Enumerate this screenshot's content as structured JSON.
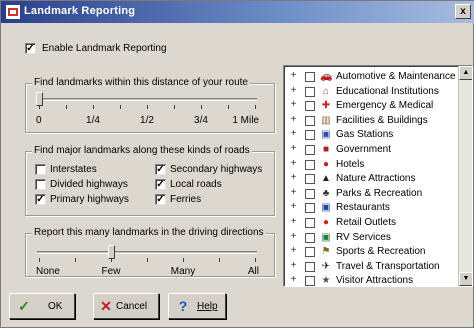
{
  "window": {
    "title": "Landmark Reporting",
    "close_label": "x"
  },
  "enable": {
    "label": "Enable Landmark Reporting",
    "checked": true
  },
  "distance": {
    "title": "Find landmarks within this distance of your route",
    "labels": [
      "0",
      "1/4",
      "1/2",
      "3/4",
      "1 Mile"
    ],
    "value_fraction": 0
  },
  "roads": {
    "title": "Find major landmarks along these kinds of roads",
    "items": [
      {
        "label": "Interstates",
        "checked": false
      },
      {
        "label": "Divided highways",
        "checked": false
      },
      {
        "label": "Primary highways",
        "checked": true
      },
      {
        "label": "Secondary highways",
        "checked": true
      },
      {
        "label": "Local roads",
        "checked": true
      },
      {
        "label": "Ferries",
        "checked": true
      }
    ]
  },
  "count": {
    "title": "Report this many landmarks in the driving directions",
    "labels": [
      "None",
      "Few",
      "Many",
      "All"
    ],
    "value_fraction": 0.333
  },
  "categories": [
    {
      "label": "Automotive & Maintenance",
      "icon": "car-icon",
      "glyph": "🚗",
      "color": "#444"
    },
    {
      "label": "Educational Institutions",
      "icon": "school-icon",
      "glyph": "⌂",
      "color": "#c03020"
    },
    {
      "label": "Emergency & Medical",
      "icon": "medical-icon",
      "glyph": "✚",
      "color": "#c82020"
    },
    {
      "label": "Facilities & Buildings",
      "icon": "building-icon",
      "glyph": "▥",
      "color": "#8a6a40"
    },
    {
      "label": "Gas Stations",
      "icon": "gas-icon",
      "glyph": "▣",
      "color": "#3050b0"
    },
    {
      "label": "Government",
      "icon": "government-icon",
      "glyph": "■",
      "color": "#b02020"
    },
    {
      "label": "Hotels",
      "icon": "hotel-icon",
      "glyph": "●",
      "color": "#c02020"
    },
    {
      "label": "Nature Attractions",
      "icon": "nature-icon",
      "glyph": "▲",
      "color": "#222"
    },
    {
      "label": "Parks & Recreation",
      "icon": "park-icon",
      "glyph": "♣",
      "color": "#333"
    },
    {
      "label": "Restaurants",
      "icon": "restaurant-icon",
      "glyph": "▣",
      "color": "#2040a0"
    },
    {
      "label": "Retail Outlets",
      "icon": "retail-icon",
      "glyph": "●",
      "color": "#d02020"
    },
    {
      "label": "RV Services",
      "icon": "rv-icon",
      "glyph": "▣",
      "color": "#208040"
    },
    {
      "label": "Sports & Recreation",
      "icon": "sports-icon",
      "glyph": "⚑",
      "color": "#8a6a20"
    },
    {
      "label": "Travel & Transportation",
      "icon": "airplane-icon",
      "glyph": "✈",
      "color": "#222"
    },
    {
      "label": "Visitor Attractions",
      "icon": "visitor-icon",
      "glyph": "★",
      "color": "#555"
    }
  ],
  "buttons": {
    "ok": "OK",
    "cancel": "Cancel",
    "help": "Help"
  },
  "colors": {
    "title_start": "#2a3f8c",
    "title_end": "#a8bce0",
    "check_green": "#2a8a2a",
    "cancel_red": "#c02020",
    "help_blue": "#2050c0"
  }
}
